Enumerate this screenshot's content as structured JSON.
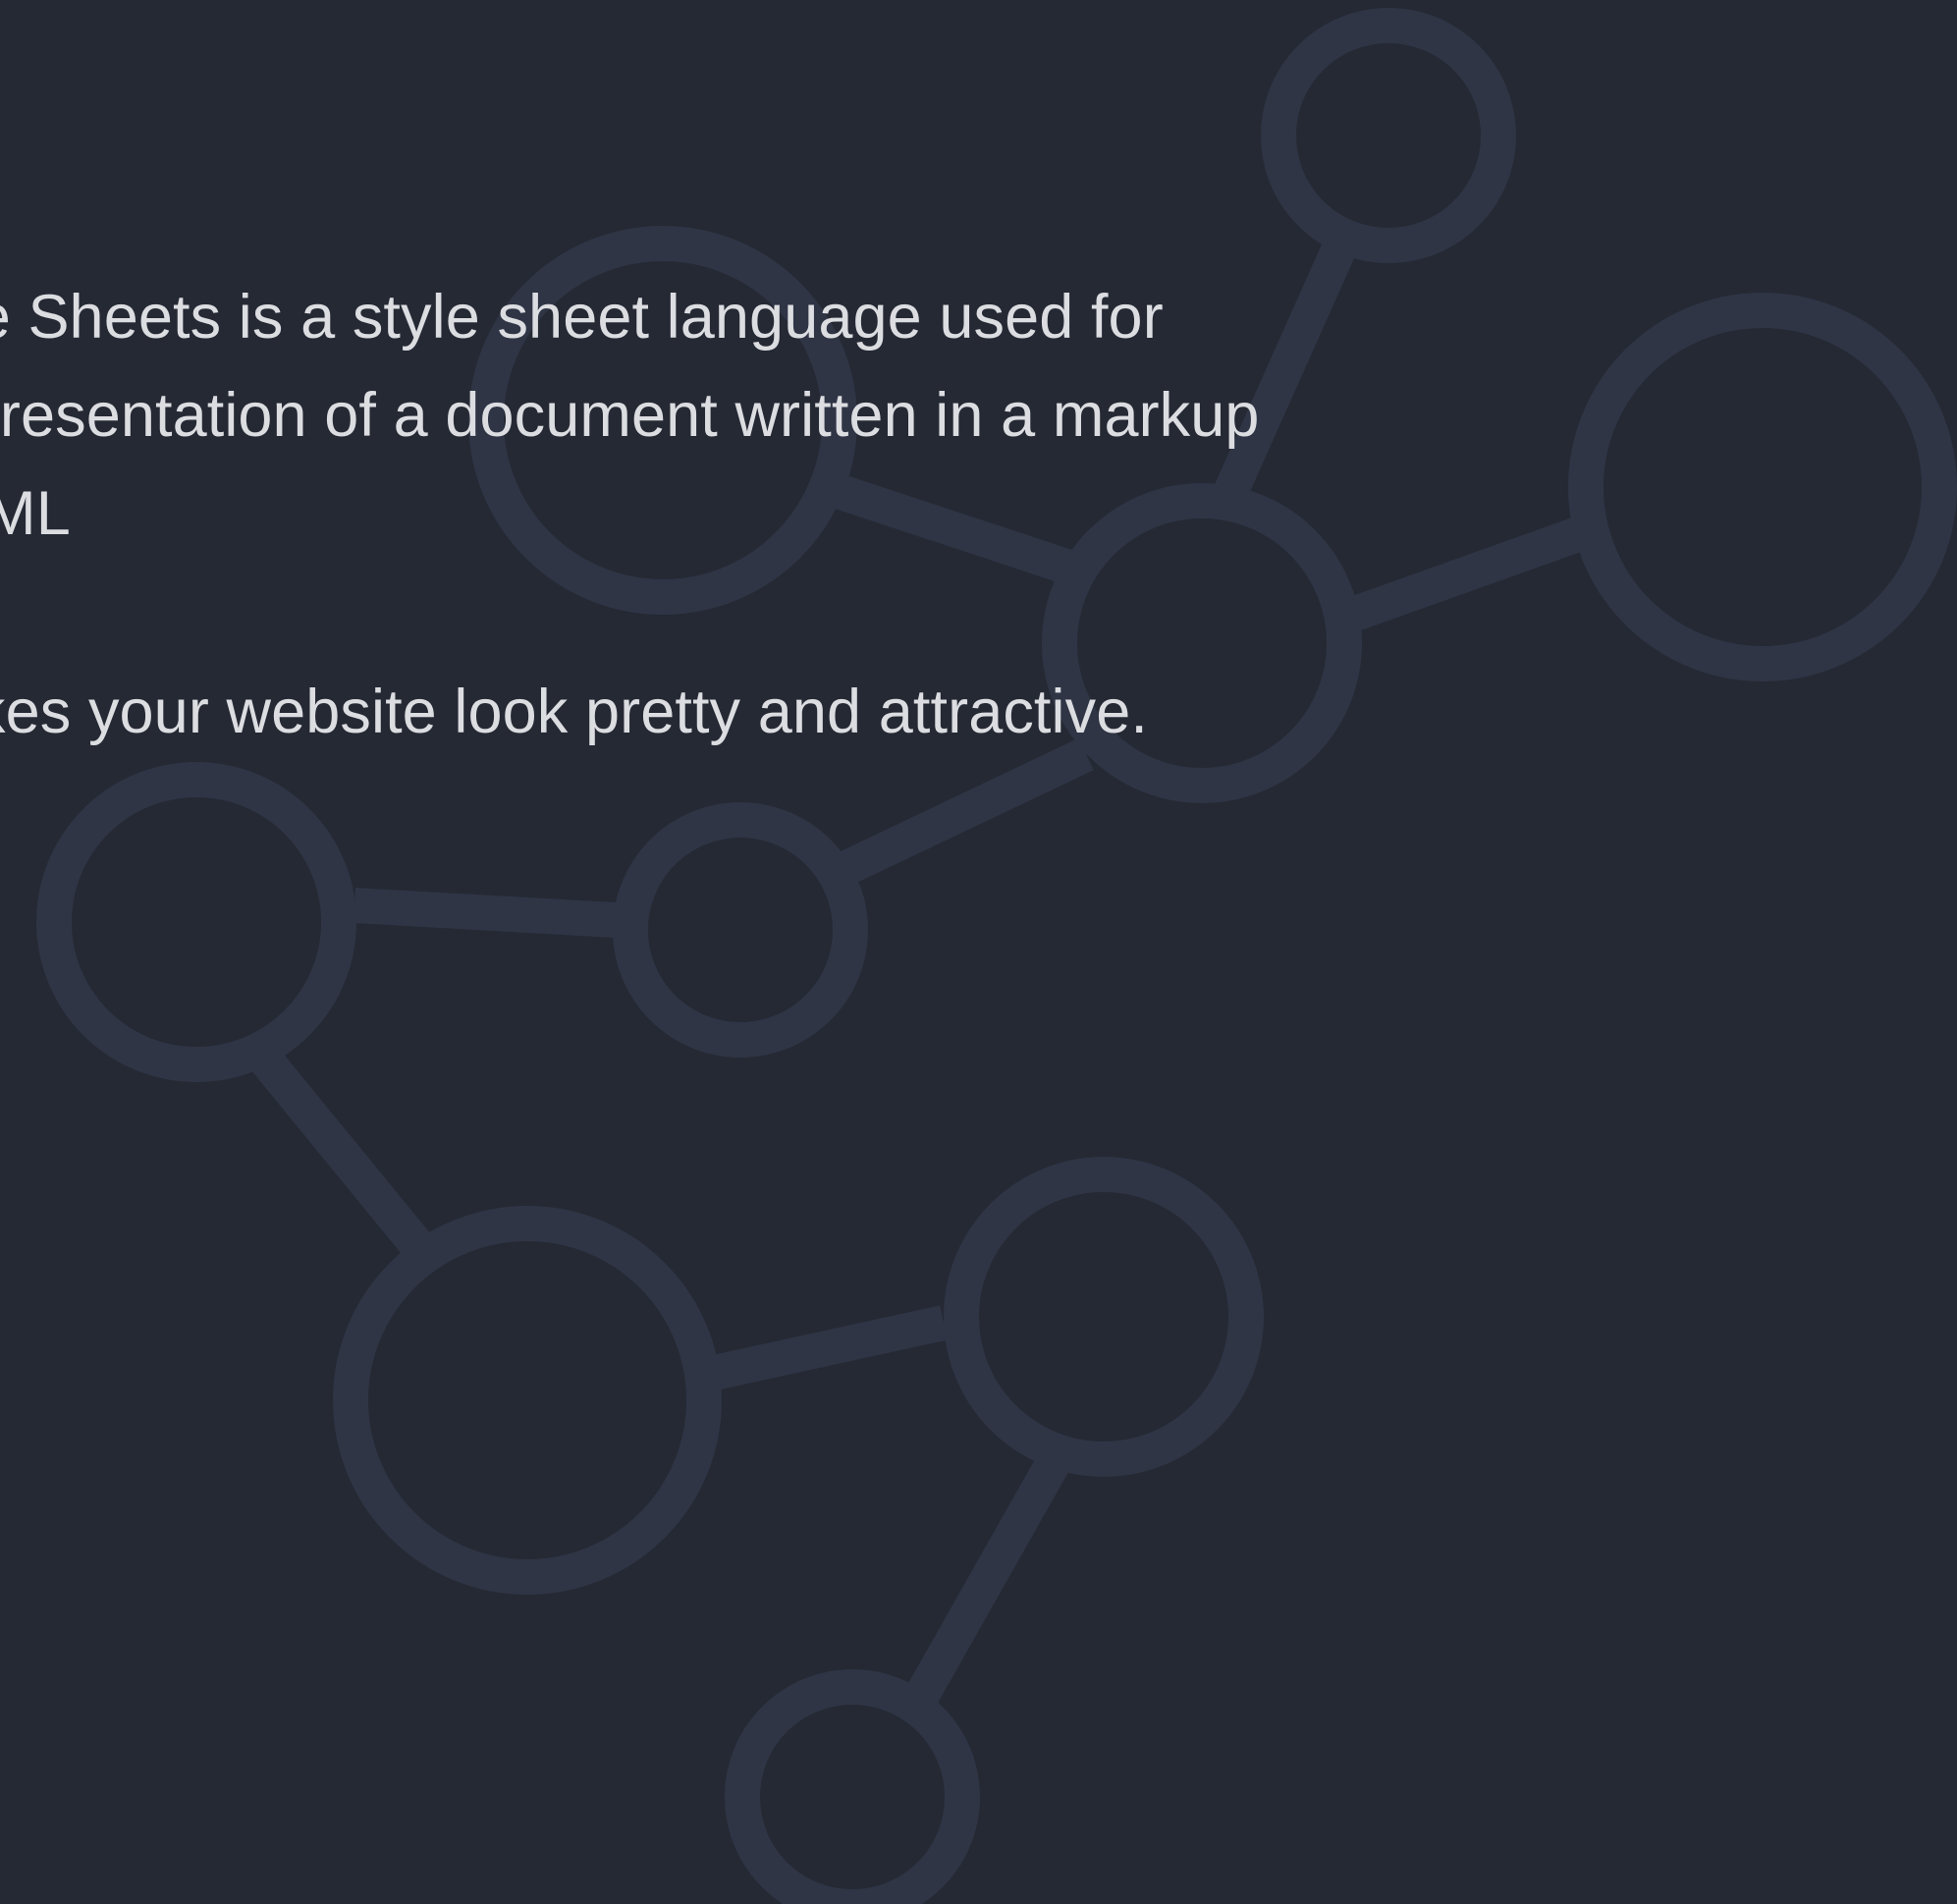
{
  "page": {
    "background_color": "#252934",
    "text_color": "#dcdde1",
    "network_color": "#2f3545"
  },
  "content": {
    "lines": [
      "yle Sheets is a style sheet language used for",
      "e presentation of a document written in a markup",
      " HTML",
      "kes your website look pretty and attractive."
    ]
  }
}
